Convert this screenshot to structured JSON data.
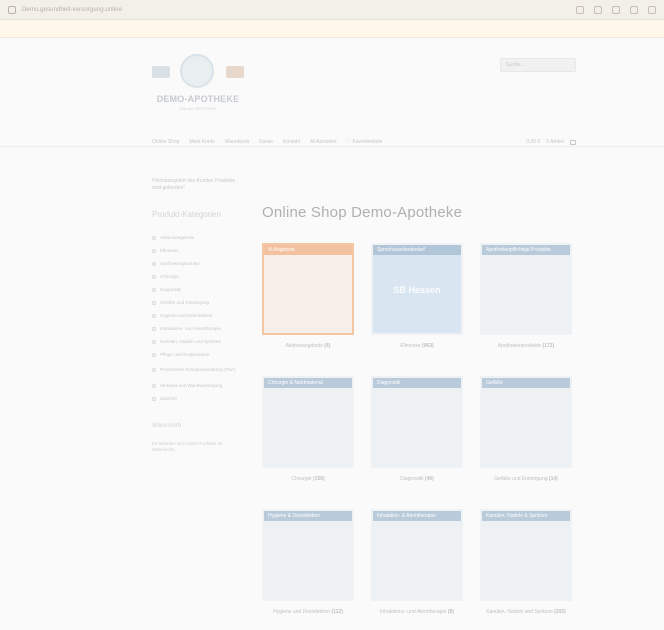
{
  "browser": {
    "url": "Demo.gesundheit-versorgung.online"
  },
  "site": {
    "logo_text": "DEMO-APOTHEKE",
    "logo_sub": "ONLINE APOTHEKE",
    "search_placeholder": "Suche...",
    "nav": [
      {
        "label": "Online Shop"
      },
      {
        "label": "Mein Konto"
      },
      {
        "label": "Warenkorb"
      },
      {
        "label": "Kasse"
      },
      {
        "label": "Kontakt"
      },
      {
        "label": "AI-Assistent"
      },
      {
        "label": "♡ Favoritenliste"
      }
    ],
    "cart": {
      "total": "0,00 €",
      "items": "0 Artikel"
    }
  },
  "sidebar": {
    "note": "Höchstangebot des Kunden Produkte sind gefunden!",
    "heading": "Produkt-Kategorien",
    "categories": [
      "Aktionsangebote",
      "Ellmesse",
      "Apothekenprodukte",
      "Chirurgie",
      "Diagnostik",
      "Gefäße und Entsorgung",
      "Hygiene und Desinfektion",
      "Inhalations- und Atemtherapie",
      "Kanülen, Nadeln und Spritzen",
      "Pflege und Endprodukte",
      "Persönliche Schutzausrüstung (PSA)",
      "Verband und Wundversorgung",
      "Zubehör"
    ],
    "sub_heading": "Warenkorb",
    "sub_note": "Es befinden sich keine Produkte im Warenkorb."
  },
  "main": {
    "title": "Online Shop Demo-Apotheke",
    "cards": [
      {
        "banner": "% Angebote",
        "label": "Aktionsangebote",
        "count": "(4)",
        "center": ""
      },
      {
        "banner": "Sprechstundenbedarf",
        "label": "Ellmesse",
        "count": "(963)",
        "center": "SB Hessen"
      },
      {
        "banner": "Apothekenpflichtige Produkte",
        "label": "Apothekenprodukte",
        "count": "(172)",
        "center": ""
      },
      {
        "banner": "Chirurgie & Nahtmaterial",
        "label": "Chirurgie",
        "count": "(156)",
        "center": ""
      },
      {
        "banner": "Diagnostik",
        "label": "Diagnostik",
        "count": "(40)",
        "center": ""
      },
      {
        "banner": "Gefäße",
        "label": "Gefäße und Entsorgung",
        "count": "(14)",
        "center": ""
      },
      {
        "banner": "Hygiene & Desinfektion",
        "label": "Hygiene und Desinfektion",
        "count": "(112)",
        "center": ""
      },
      {
        "banner": "Inhalation- & Atemtherapie",
        "label": "Inhalations- und Atemtherapie",
        "count": "(8)",
        "center": ""
      },
      {
        "banner": "Kanülen, Nadeln & Spritzen",
        "label": "Kanülen, Nadeln und Spritzen",
        "count": "(202)",
        "center": ""
      }
    ]
  }
}
